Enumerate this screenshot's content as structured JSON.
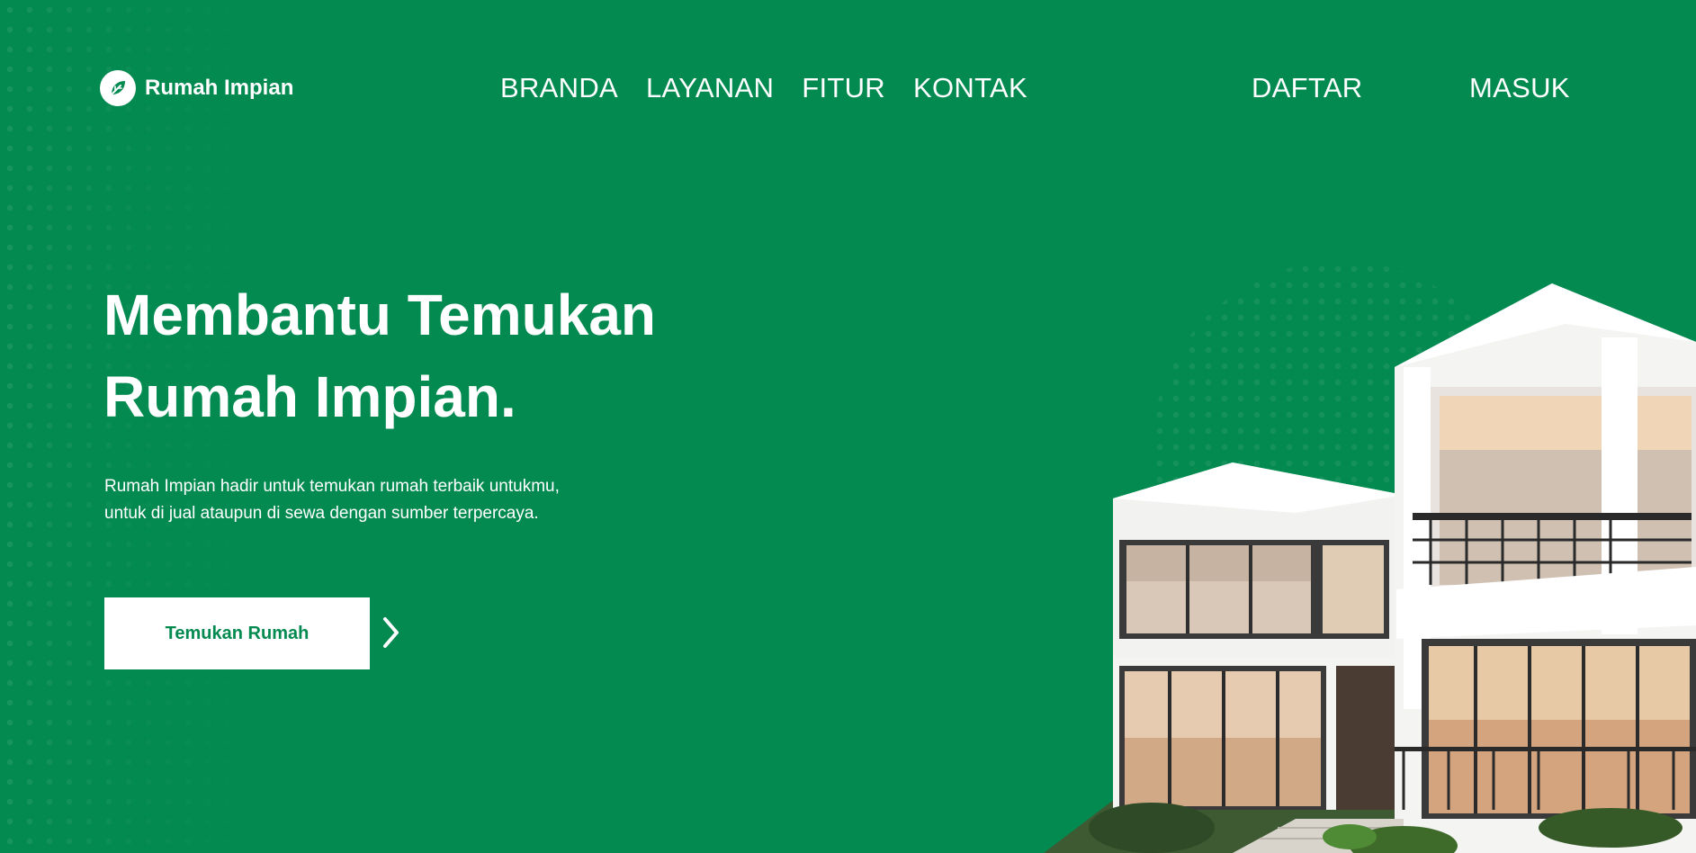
{
  "header": {
    "brand": "Rumah Impian",
    "nav": [
      {
        "label": "BRANDA"
      },
      {
        "label": "LAYANAN"
      },
      {
        "label": "FITUR"
      },
      {
        "label": "KONTAK"
      }
    ],
    "register_label": "DAFTAR",
    "login_label": "MASUK"
  },
  "hero": {
    "title_line1": "Membantu Temukan",
    "title_line2": "Rumah Impian.",
    "description": "Rumah Impian hadir untuk temukan rumah terbaik untukmu, untuk di jual ataupun di sewa dengan sumber terpercaya.",
    "cta_label": "Temukan Rumah"
  },
  "icons": {
    "logo": "leaf-logo-icon",
    "cta_arrow": "chevron-right-icon"
  },
  "colors": {
    "brand_green": "#038a50",
    "white": "#ffffff"
  }
}
